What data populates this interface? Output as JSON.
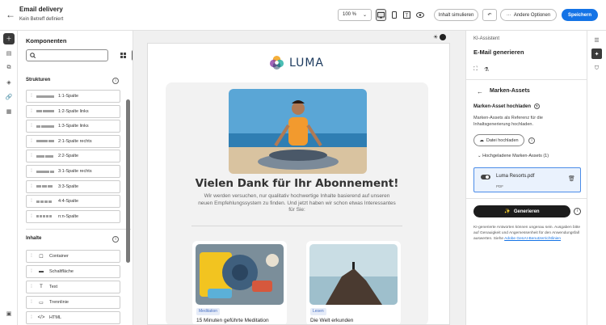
{
  "header": {
    "title": "Email delivery",
    "subtitle": "Kein Betreff definiert",
    "zoom": "100 %",
    "simulate_label": "Inhalt simulieren",
    "more_label": "Andere Optionen",
    "save_label": "Speichern"
  },
  "components": {
    "title": "Komponenten",
    "structures_label": "Strukturen",
    "structures": [
      {
        "label": "1:1-Spalte",
        "cols": [
          22
        ]
      },
      {
        "label": "1:2-Spalte links",
        "cols": [
          7,
          14
        ]
      },
      {
        "label": "1:3-Spalte links",
        "cols": [
          5,
          16
        ]
      },
      {
        "label": "2:1-Spalte rechts",
        "cols": [
          14,
          7
        ]
      },
      {
        "label": "2:2-Spalte",
        "cols": [
          10,
          10
        ]
      },
      {
        "label": "3:1-Spalte rechts",
        "cols": [
          16,
          5
        ]
      },
      {
        "label": "3:3-Spalte",
        "cols": [
          6,
          6,
          6
        ]
      },
      {
        "label": "4:4-Spalte",
        "cols": [
          4,
          4,
          4,
          4
        ]
      },
      {
        "label": "n:n-Spalte",
        "cols": [
          3,
          3,
          3,
          3,
          3
        ]
      }
    ],
    "content_label": "Inhalte",
    "contents": [
      {
        "label": "Container",
        "icon": "container-icon",
        "glyph": "☐"
      },
      {
        "label": "Schaltfläche",
        "icon": "button-icon",
        "glyph": "▬"
      },
      {
        "label": "Text",
        "icon": "text-icon",
        "glyph": "T"
      },
      {
        "label": "Trennlinie",
        "icon": "divider-icon",
        "glyph": "▭"
      },
      {
        "label": "HTML",
        "icon": "html-icon",
        "glyph": "</>"
      }
    ]
  },
  "email": {
    "logo_text": "LUMA",
    "heading": "Vielen Dank für Ihr Abonnement!",
    "lead": "Wir werden versuchen, nur qualitativ hochwertige Inhalte basierend auf unseren neuen Empfehlungssystem zu finden. Und jetzt haben wir schon etwas Interessantes für Sie:",
    "articles": [
      {
        "tag": "Meditation",
        "title": "15 Minuten geführte Meditation"
      },
      {
        "tag": "Lesen",
        "title": "Die Welt erkunden"
      }
    ]
  },
  "assistant": {
    "small_title": "KI-Assistent",
    "title": "E-Mail generieren",
    "section_title": "Marken-Assets",
    "upload_label": "Marken-Asset hochladen",
    "upload_desc": "Marken-Assets als Referenz für die Inhaltsgenerierung hochladen.",
    "upload_button": "Datei hochladen",
    "accordion_label": "Hochgeladene Marken-Assets (1)",
    "file_name": "Luma Resorts.pdf",
    "file_type": "PDF",
    "generate_label": "Generieren",
    "disclaimer": "KI-generierte Antworten können ungenau sein. Ausgaben bitte auf Genauigkeit und Angemessenheit für den Anwendungsfall auswerten. Siehe",
    "disclaimer_link": "Adobe GenAI-Benutzerrichtlinien"
  },
  "colors": {
    "accent": "#1473e6",
    "dark_button": "#1c1c1c",
    "selected_card_bg": "#eaf2fd"
  }
}
